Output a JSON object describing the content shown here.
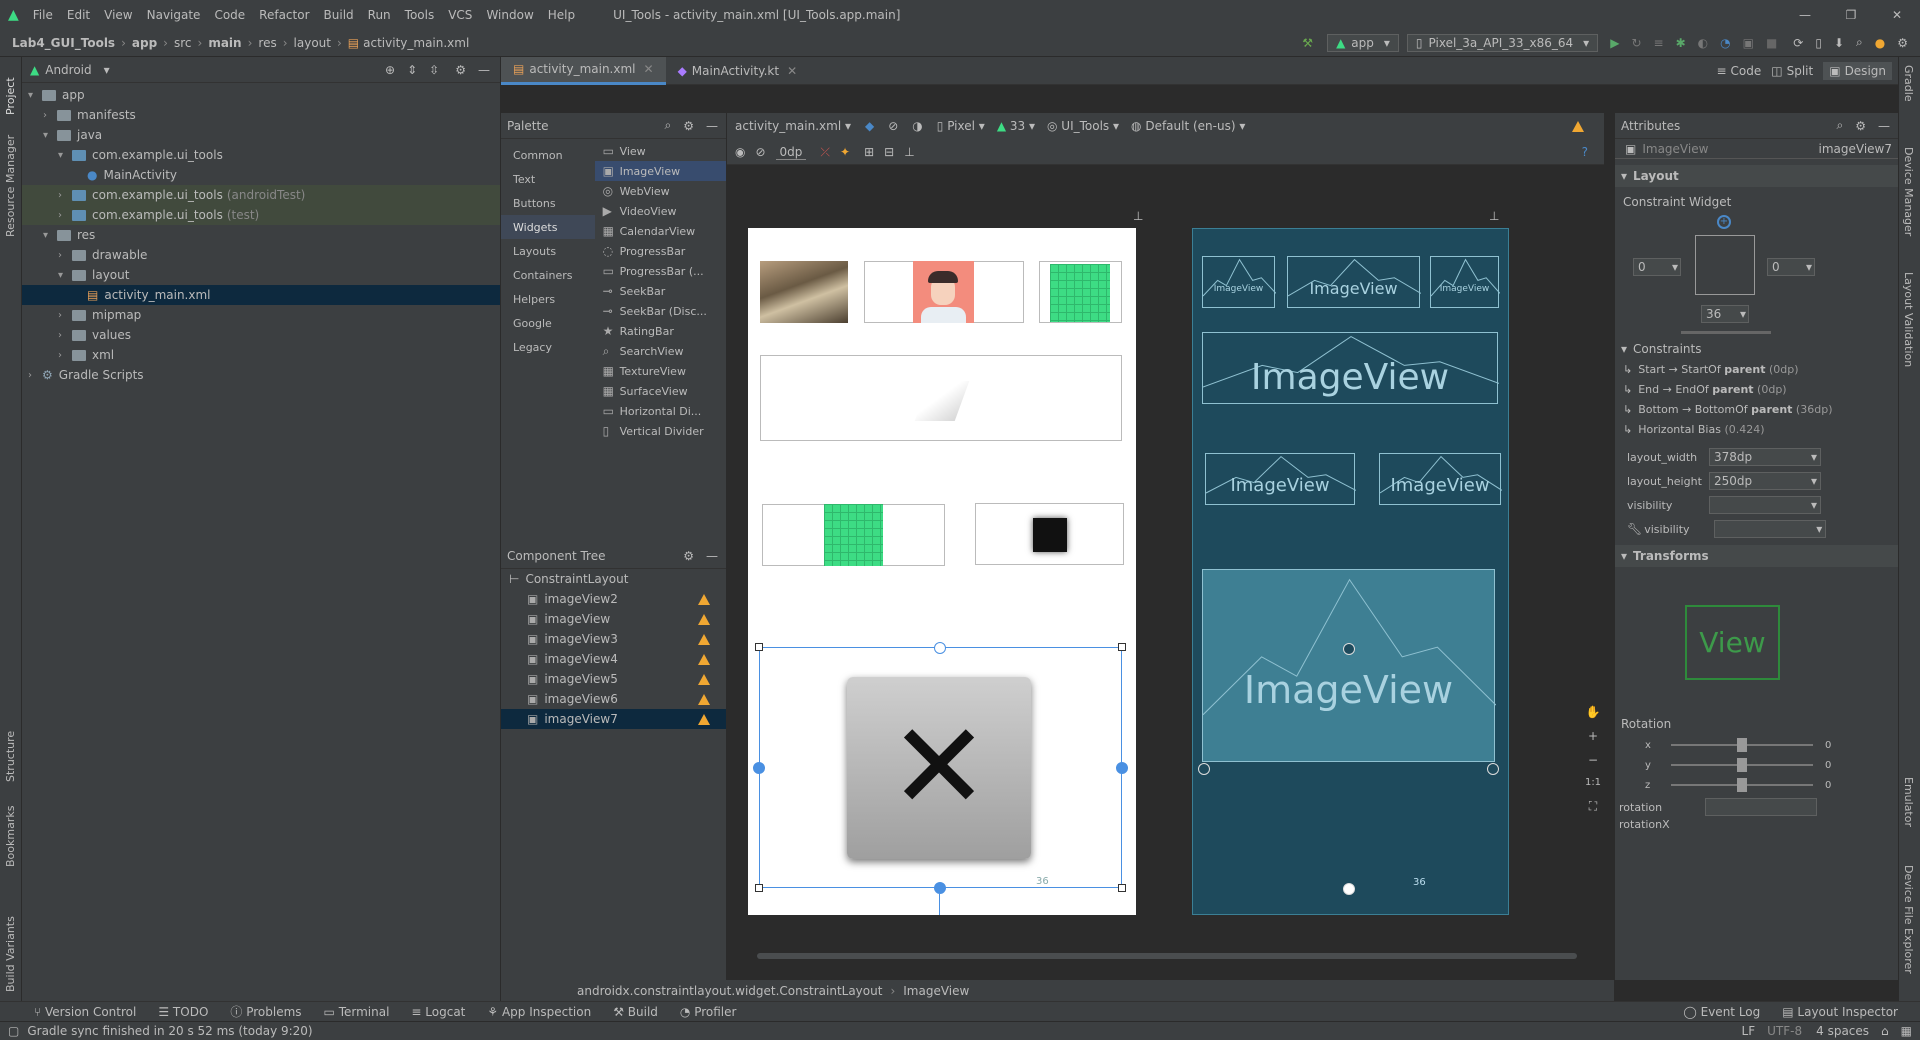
{
  "menu": {
    "items": [
      "File",
      "Edit",
      "View",
      "Navigate",
      "Code",
      "Refactor",
      "Build",
      "Run",
      "Tools",
      "VCS",
      "Window",
      "Help"
    ],
    "title": "UI_Tools - activity_main.xml [UI_Tools.app.main]"
  },
  "nav": {
    "crumbs": [
      "Lab4_GUI_Tools",
      "app",
      "src",
      "main",
      "res",
      "layout",
      "activity_main.xml"
    ],
    "run_config": "app",
    "device": "Pixel_3a_API_33_x86_64"
  },
  "left_strip": {
    "project": "Project",
    "resource_manager": "Resource Manager",
    "structure": "Structure",
    "bookmarks": "Bookmarks",
    "build_variants": "Build Variants"
  },
  "right_strip": {
    "gradle": "Gradle",
    "device_manager": "Device Manager",
    "layout_validation": "Layout Validation",
    "emulator": "Emulator",
    "device_file_explorer": "Device File Explorer"
  },
  "project": {
    "view_mode": "Android",
    "tree": [
      {
        "label": "app",
        "indent": 0,
        "arrow": "v",
        "icon": "folder"
      },
      {
        "label": "manifests",
        "indent": 1,
        "arrow": ">",
        "icon": "folder"
      },
      {
        "label": "java",
        "indent": 1,
        "arrow": "v",
        "icon": "folder"
      },
      {
        "label": "com.example.ui_tools",
        "indent": 2,
        "arrow": "v",
        "icon": "folder"
      },
      {
        "label": "MainActivity",
        "indent": 3,
        "arrow": "",
        "icon": "kotlin"
      },
      {
        "label": "com.example.ui_tools",
        "suffix": "(androidTest)",
        "indent": 2,
        "arrow": ">",
        "icon": "folder",
        "hl": true
      },
      {
        "label": "com.example.ui_tools",
        "suffix": "(test)",
        "indent": 2,
        "arrow": ">",
        "icon": "folder",
        "hl": true
      },
      {
        "label": "res",
        "indent": 1,
        "arrow": "v",
        "icon": "folder"
      },
      {
        "label": "drawable",
        "indent": 2,
        "arrow": ">",
        "icon": "folder"
      },
      {
        "label": "layout",
        "indent": 2,
        "arrow": "v",
        "icon": "folder"
      },
      {
        "label": "activity_main.xml",
        "indent": 3,
        "arrow": "",
        "icon": "xml",
        "sel": true
      },
      {
        "label": "mipmap",
        "indent": 2,
        "arrow": ">",
        "icon": "folder"
      },
      {
        "label": "values",
        "indent": 2,
        "arrow": ">",
        "icon": "folder"
      },
      {
        "label": "xml",
        "indent": 2,
        "arrow": ">",
        "icon": "folder"
      },
      {
        "label": "Gradle Scripts",
        "indent": 0,
        "arrow": ">",
        "icon": "gradle"
      }
    ]
  },
  "tabs": [
    {
      "label": "activity_main.xml",
      "active": true
    },
    {
      "label": "MainActivity.kt",
      "active": false
    }
  ],
  "view_modes": {
    "code": "Code",
    "split": "Split",
    "design": "Design"
  },
  "palette": {
    "title": "Palette",
    "categories": [
      "Common",
      "Text",
      "Buttons",
      "Widgets",
      "Layouts",
      "Containers",
      "Helpers",
      "Google",
      "Legacy"
    ],
    "selected_category": "Widgets",
    "items": [
      "View",
      "ImageView",
      "WebView",
      "VideoView",
      "CalendarView",
      "ProgressBar",
      "ProgressBar (...",
      "SeekBar",
      "SeekBar (Disc...",
      "RatingBar",
      "SearchView",
      "TextureView",
      "SurfaceView",
      "Horizontal Di...",
      "Vertical Divider"
    ],
    "selected_item": "ImageView"
  },
  "component_tree": {
    "title": "Component Tree",
    "root": "ConstraintLayout",
    "children": [
      "imageView2",
      "imageView",
      "imageView3",
      "imageView4",
      "imageView5",
      "imageView6",
      "imageView7"
    ],
    "selected": "imageView7"
  },
  "design_toolbar": {
    "file": "activity_main.xml",
    "device": "Pixel",
    "api": "33",
    "theme": "UI_Tools",
    "locale": "Default (en-us)",
    "margin": "0dp"
  },
  "blueprint": {
    "label": "ImageView",
    "dim": "36"
  },
  "breadcrumb": [
    "androidx.constraintlayout.widget.ConstraintLayout",
    "ImageView"
  ],
  "attributes": {
    "title": "Attributes",
    "widget_type": "ImageView",
    "widget_id": "imageView7",
    "layout_section": "Layout",
    "constraint_widget": "Constraint Widget",
    "margins": {
      "left": "0",
      "right": "0",
      "bottom": "36"
    },
    "constraints_section": "Constraints",
    "constraints": [
      {
        "pre": "Start → StartOf ",
        "bold": "parent",
        "post": " (0dp)"
      },
      {
        "pre": "End → EndOf ",
        "bold": "parent",
        "post": " (0dp)"
      },
      {
        "pre": "Bottom → BottomOf ",
        "bold": "parent",
        "post": " (36dp)"
      },
      {
        "pre": "Horizontal Bias ",
        "bold": "",
        "post": "(0.424)"
      }
    ],
    "layout_width_label": "layout_width",
    "layout_width": "378dp",
    "layout_height_label": "layout_height",
    "layout_height": "250dp",
    "visibility_label": "visibility",
    "tools_visibility_label": "visibility",
    "transforms_section": "Transforms",
    "preview_label": "View",
    "rotation_title": "Rotation",
    "rot": [
      {
        "axis": "x",
        "value": "0"
      },
      {
        "axis": "y",
        "value": "0"
      },
      {
        "axis": "z",
        "value": "0"
      }
    ],
    "rotation_label": "rotation",
    "rotationX_label": "rotationX"
  },
  "bottom_tools": [
    "Version Control",
    "TODO",
    "Problems",
    "Terminal",
    "Logcat",
    "App Inspection",
    "Build",
    "Profiler"
  ],
  "bottom_right": [
    "Event Log",
    "Layout Inspector"
  ],
  "status": {
    "message": "Gradle sync finished in 20 s 52 ms (today 9:20)",
    "lf": "LF",
    "enc": "UTF-8",
    "indent": "4 spaces"
  },
  "colors": {
    "blueprint_bg": "#1e4a5c",
    "selection": "#4a90e2",
    "warning": "#f0a732",
    "android_green": "#3ddc84"
  }
}
